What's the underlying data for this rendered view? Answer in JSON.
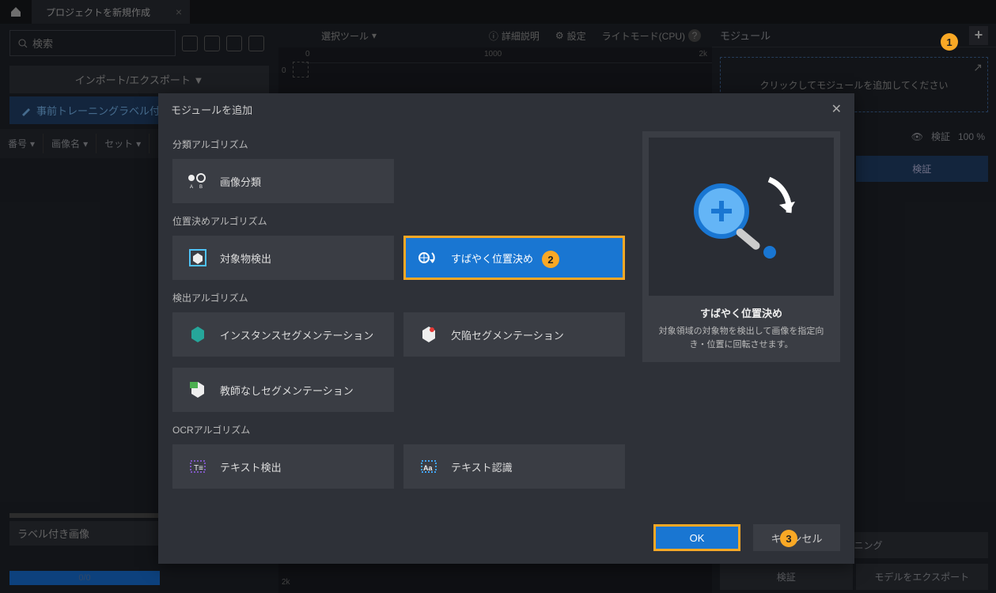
{
  "topbar": {
    "tab_label": "プロジェクトを新規作成"
  },
  "left": {
    "search_placeholder": "検索",
    "import_export": "インポート/エクスポート ▼",
    "pretrain_label": "事前トレーニングラベル付け",
    "cols": {
      "c1": "番号",
      "c2": "画像名",
      "c3": "セット"
    },
    "labeled_images": "ラベル付き画像",
    "progress_text": "0/0"
  },
  "center_toolbar": {
    "select_tool": "選択ツール",
    "detail": "詳細説明",
    "settings": "設定",
    "light_mode": "ライトモード(CPU)"
  },
  "ruler": {
    "r0": "0",
    "r1000": "1000",
    "r2k": "2k"
  },
  "right": {
    "title": "モジュール",
    "placeholder": "クリックしてモジュールを追加してください",
    "verify": "検証",
    "verify_pct": "100 %",
    "tab_training": "トレーニング",
    "tab_verify": "検証",
    "btn_verify": "検証",
    "btn_export": "モデルをエクスポート"
  },
  "dialog": {
    "title": "モジュールを追加",
    "sections": {
      "classification": "分類アルゴリズム",
      "positioning": "位置決めアルゴリズム",
      "detection": "検出アルゴリズム",
      "ocr": "OCRアルゴリズム"
    },
    "cards": {
      "image_classification": "画像分類",
      "object_detection": "対象物検出",
      "fast_positioning": "すばやく位置決め",
      "instance_seg": "インスタンスセグメンテーション",
      "defect_seg": "欠陥セグメンテーション",
      "unsupervised_seg": "教師なしセグメンテーション",
      "text_detection": "テキスト検出",
      "text_recognition": "テキスト認識"
    },
    "preview": {
      "title": "すばやく位置決め",
      "desc": "対象領域の対象物を検出して画像を指定向き・位置に回転させます。"
    },
    "ok": "OK",
    "cancel": "キャンセル"
  },
  "callouts": {
    "c1": "1",
    "c2": "2",
    "c3": "3"
  }
}
